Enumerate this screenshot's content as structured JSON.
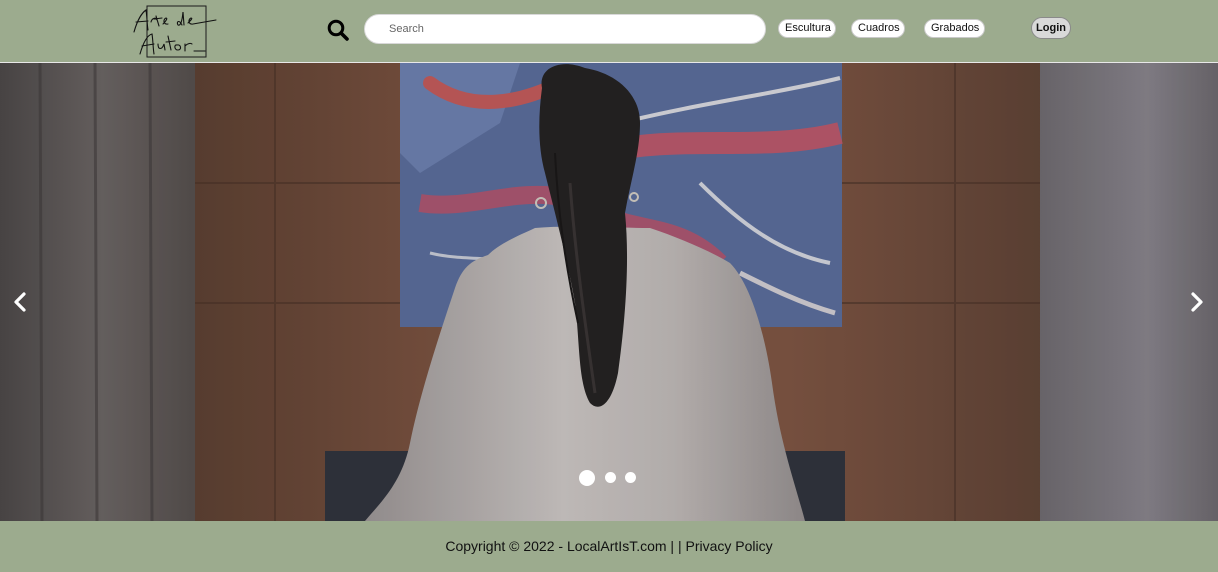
{
  "header": {
    "logo_text": "Arte de Autor",
    "search": {
      "placeholder": "Search",
      "value": ""
    },
    "nav": [
      {
        "label": "Escultura"
      },
      {
        "label": "Cuadros"
      },
      {
        "label": "Grabados"
      }
    ],
    "login_label": "Login"
  },
  "carousel": {
    "slide_count": 3,
    "active_slide": 1,
    "prev_icon": "chevron-left-icon",
    "next_icon": "chevron-right-icon"
  },
  "footer": {
    "copyright": "Copyright © 2022 - ",
    "site_link": "LocalArtIsT.com",
    "separator": " | | ",
    "privacy_link": "Privacy Policy"
  },
  "colors": {
    "header_bg": "#9cab8e",
    "footer_bg": "#9cab8e",
    "button_bg": "#ffffff",
    "login_bg": "#d9d9d9"
  }
}
